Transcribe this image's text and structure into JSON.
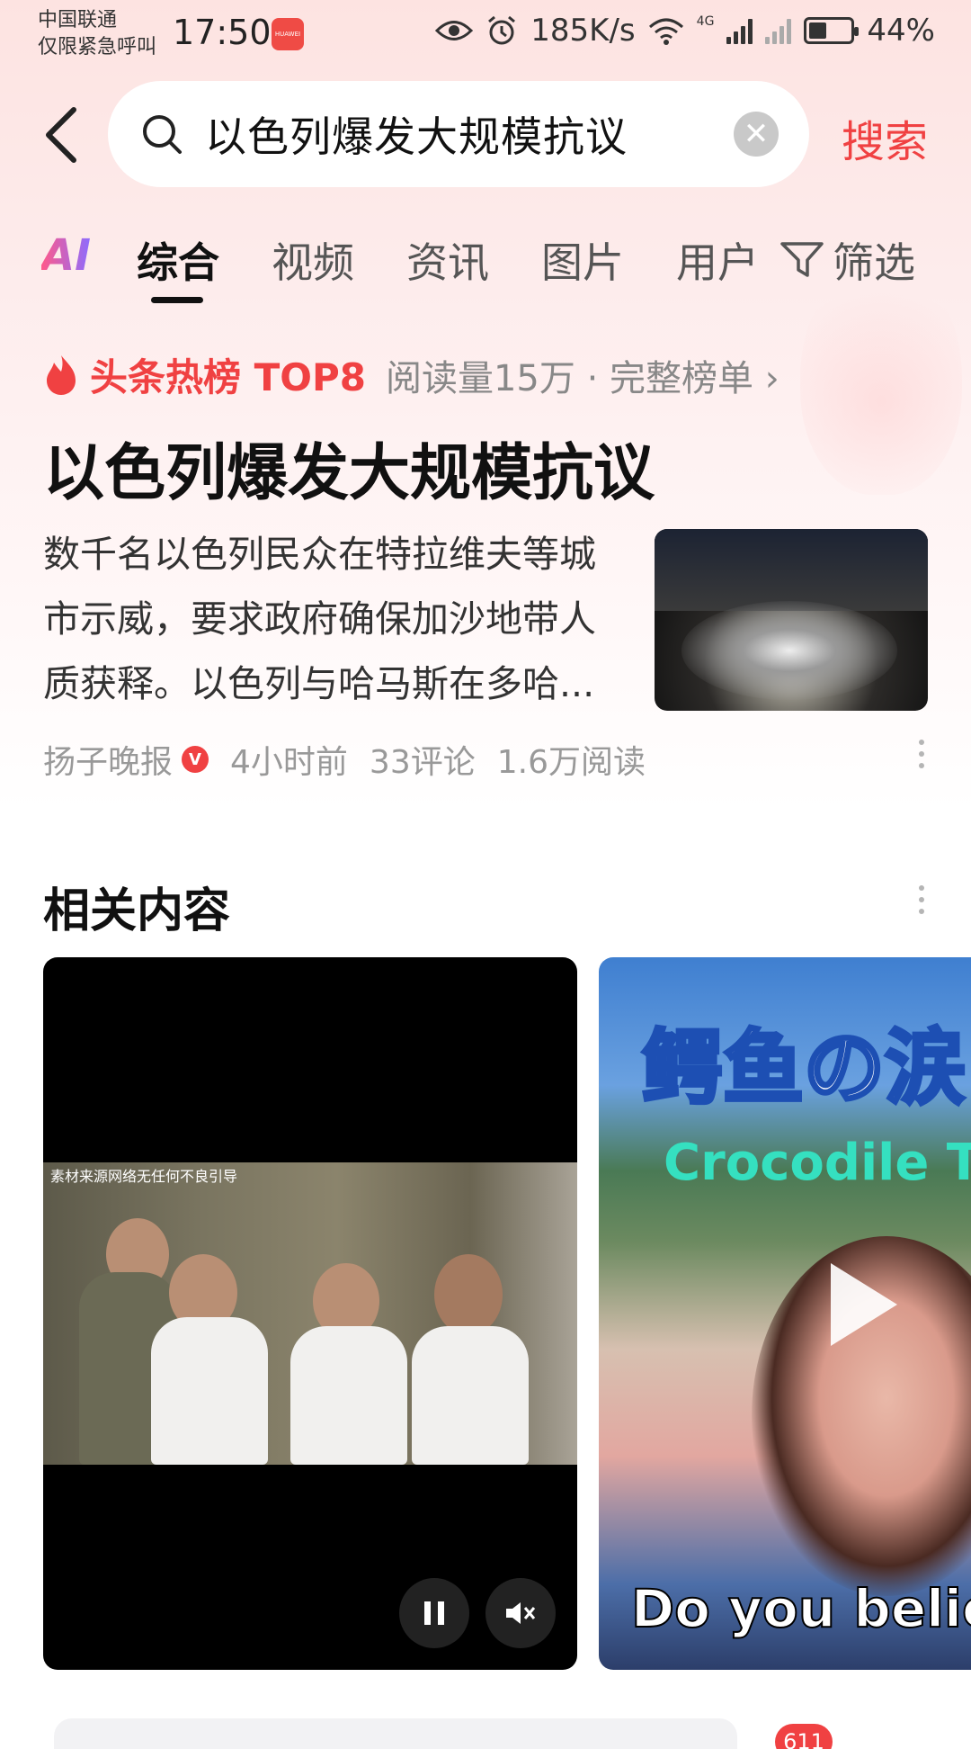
{
  "status_bar": {
    "carrier_line1": "中国联通",
    "carrier_line2": "仅限紧急呼叫",
    "time": "17:50",
    "app_badge": "HUAWEI",
    "network_speed": "185K/s",
    "network_type": "4G",
    "battery_percent": "44%",
    "battery_level": 0.44
  },
  "search": {
    "query": "以色列爆发大规模抗议",
    "submit_label": "搜索"
  },
  "tabs": {
    "ai_label": "AI",
    "items": [
      "综合",
      "视频",
      "资讯",
      "图片",
      "用户"
    ],
    "active_index": 0,
    "filter_label": "筛选"
  },
  "hot_card": {
    "rank_label": "头条热榜 TOP8",
    "meta": "阅读量15万 · 完整榜单 ›",
    "headline": "以色列爆发大规模抗议",
    "summary": "数千名以色列民众在特拉维夫等城市示威，要求政府确保加沙地带人质获释。以色列与哈马斯在多哈...",
    "source": "扬子晚报",
    "verified_mark": "V",
    "time_ago": "4小时前",
    "comments": "33评论",
    "reads": "1.6万阅读"
  },
  "related": {
    "title": "相关内容",
    "video1_caption": "素材来源网络无任何不良引导",
    "video2_title_ja": "鳄鱼の涙",
    "video2_title_en": "Crocodile Te",
    "video2_subtitle": "Do you believ"
  },
  "bottom": {
    "badge_count": "611"
  },
  "colors": {
    "accent_red": "#f04142",
    "text_primary": "#111111",
    "text_secondary": "#999999"
  }
}
